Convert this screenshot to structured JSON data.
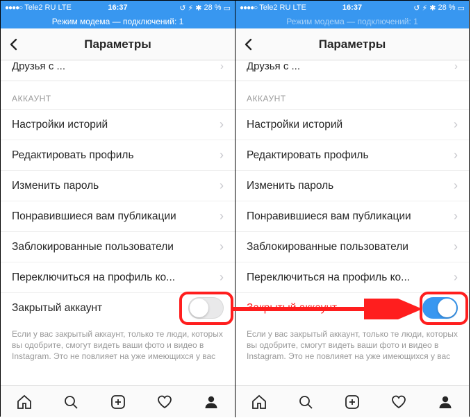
{
  "status": {
    "signal_dots": "●●●●○",
    "carrier": "Tele2 RU",
    "network": "LTE",
    "time": "16:37",
    "bt_battery": "28 %",
    "hotspot_full": "Режим модема — подключений: 1",
    "hotspot_dim": "Режим модема — подключений: 1"
  },
  "nav": {
    "title": "Параметры"
  },
  "cut_row": "друзья с тт",
  "section": "АККАУНТ",
  "rows": {
    "story": "Настройки историй",
    "edit": "Редактировать профиль",
    "password": "Изменить пароль",
    "liked": "Понравившиеся вам публикации",
    "blocked": "Заблокированные пользователи",
    "switch_profile": "Переключиться на профиль ко...",
    "private": "Закрытый аккаунт"
  },
  "footer": "Если у вас закрытый аккаунт, только те люди, которых вы одобрите, смогут видеть ваши фото и видео в Instagram. Это не повлияет на уже имеющихся у вас"
}
